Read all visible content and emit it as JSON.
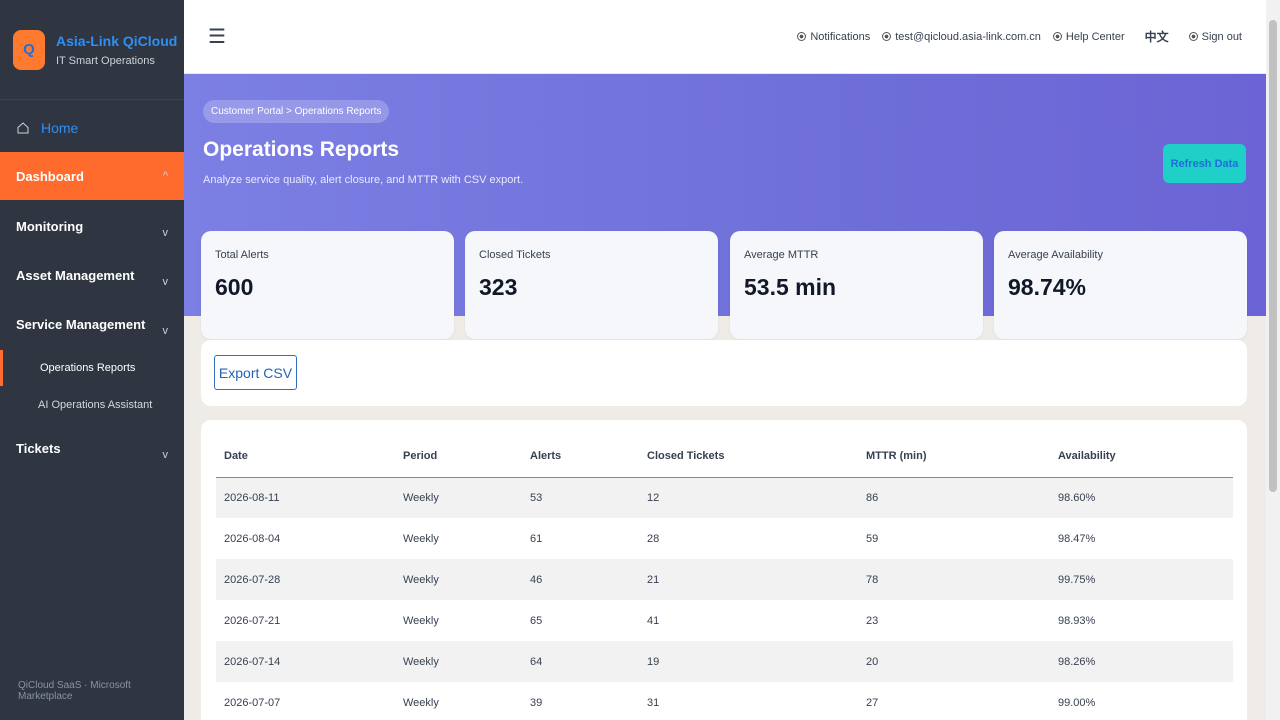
{
  "brand": {
    "name": "Asia-Link QiCloud",
    "subtitle": "IT Smart Operations",
    "logo_letter": "Q"
  },
  "sidebar": {
    "home": "Home",
    "items": [
      {
        "label": "Dashboard",
        "chevron": "^"
      },
      {
        "label": "Monitoring",
        "chevron": "v"
      },
      {
        "label": "Asset Management",
        "chevron": "v"
      },
      {
        "label": "Service Management",
        "chevron": "v"
      },
      {
        "label": "Tickets",
        "chevron": "v"
      }
    ],
    "sub_items": [
      "Operations Reports",
      "AI Operations Assistant"
    ],
    "footer": "QiCloud SaaS · Microsoft Marketplace"
  },
  "topbar": {
    "menu_icon": "☰",
    "notifications": "Notifications",
    "email": "test@qicloud.asia-link.com.cn",
    "help": "Help Center",
    "language": "中文",
    "sign_out": "Sign out"
  },
  "hero": {
    "breadcrumb": "Customer Portal > Operations Reports",
    "title": "Operations Reports",
    "subtitle": "Analyze service quality, alert closure, and MTTR with CSV export.",
    "refresh_label": "Refresh Data"
  },
  "cards": [
    {
      "label": "Total Alerts",
      "value": "600"
    },
    {
      "label": "Closed Tickets",
      "value": "323"
    },
    {
      "label": "Average MTTR",
      "value": "53.5 min"
    },
    {
      "label": "Average Availability",
      "value": "98.74%"
    }
  ],
  "export_label": "Export CSV",
  "table": {
    "headers": [
      "Date",
      "Period",
      "Alerts",
      "Closed Tickets",
      "MTTR (min)",
      "Availability"
    ],
    "rows": [
      [
        "2026-08-11",
        "Weekly",
        "53",
        "12",
        "86",
        "98.60%"
      ],
      [
        "2026-08-04",
        "Weekly",
        "61",
        "28",
        "59",
        "98.47%"
      ],
      [
        "2026-07-28",
        "Weekly",
        "46",
        "21",
        "78",
        "99.75%"
      ],
      [
        "2026-07-21",
        "Weekly",
        "65",
        "41",
        "23",
        "98.93%"
      ],
      [
        "2026-07-14",
        "Weekly",
        "64",
        "19",
        "20",
        "98.26%"
      ],
      [
        "2026-07-07",
        "Weekly",
        "39",
        "31",
        "27",
        "99.00%"
      ]
    ]
  },
  "colors": {
    "accent": "#ff6b2c",
    "hero": "#7c7fe4",
    "refresh": "#1fd0c8",
    "sidebar": "#2f3541"
  }
}
